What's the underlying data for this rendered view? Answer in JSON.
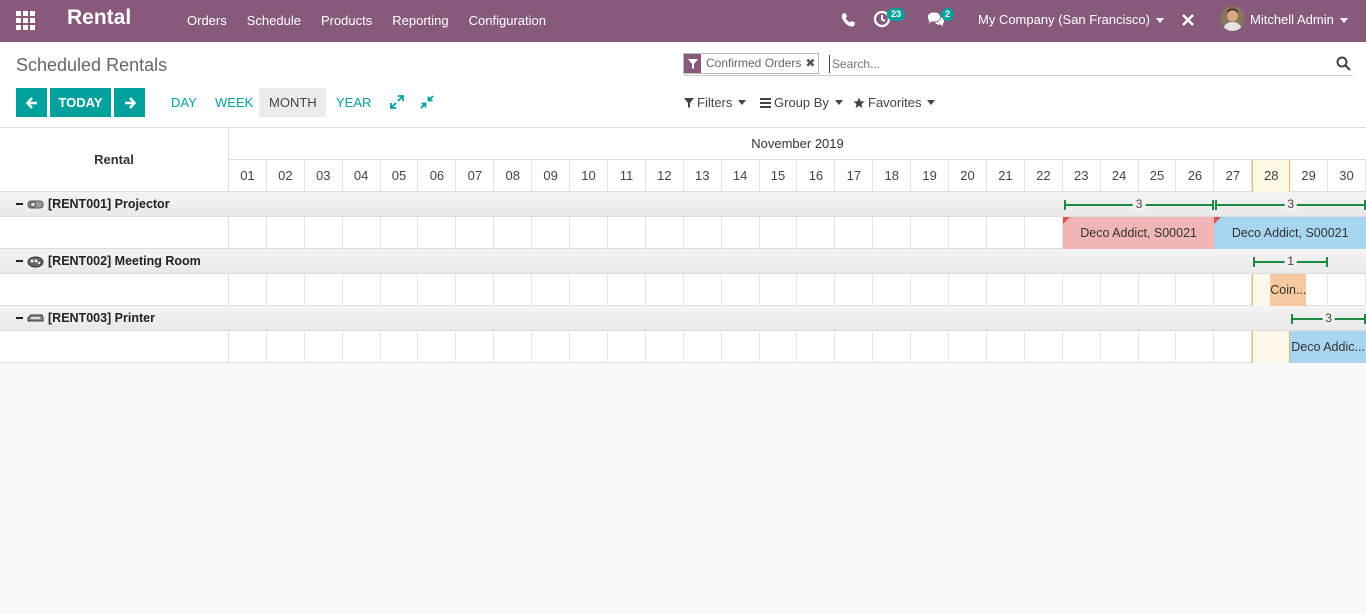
{
  "navbar": {
    "brand": "Rental",
    "menu": [
      "Orders",
      "Schedule",
      "Products",
      "Reporting",
      "Configuration"
    ],
    "activity_count": "23",
    "message_count": "2",
    "company": "My Company (San Francisco)",
    "user": "Mitchell Admin",
    "bg_color": "#875a7b"
  },
  "control": {
    "breadcrumb": "Scheduled Rentals",
    "today_label": "TODAY",
    "scales": [
      "DAY",
      "WEEK",
      "MONTH",
      "YEAR"
    ],
    "active_scale": "MONTH",
    "facet_label": "Confirmed Orders",
    "search_placeholder": "Search...",
    "filters_label": "Filters",
    "groupby_label": "Group By",
    "favorites_label": "Favorites",
    "accent_color": "#00a09d"
  },
  "gantt": {
    "row_header": "Rental",
    "month": "November 2019",
    "days": [
      "01",
      "02",
      "03",
      "04",
      "05",
      "06",
      "07",
      "08",
      "09",
      "10",
      "11",
      "12",
      "13",
      "14",
      "15",
      "16",
      "17",
      "18",
      "19",
      "20",
      "21",
      "22",
      "23",
      "24",
      "25",
      "26",
      "27",
      "28",
      "29",
      "30"
    ],
    "today": "28",
    "groups": [
      {
        "label": "[RENT001] Projector",
        "icon": "projector-icon",
        "brackets": [
          {
            "count": "3",
            "from": "23",
            "to": "26"
          },
          {
            "count": "3",
            "from": "27",
            "to": "30"
          }
        ],
        "pills": [
          {
            "text": "Deco Addict, S00021",
            "from": "23",
            "to": "26",
            "color": "#f2b5b5",
            "corner": true
          },
          {
            "text": "Deco Addict, S00021",
            "from": "27",
            "to": "30",
            "color": "#a8d5f0",
            "corner": true
          }
        ]
      },
      {
        "label": "[RENT002] Meeting Room",
        "icon": "meeting-room-icon",
        "brackets": [
          {
            "count": "1",
            "from": "28",
            "to": "29"
          }
        ],
        "pills": [
          {
            "text": "Coin...",
            "from": "28",
            "to": "28",
            "color": "#f7c9a0",
            "corner": false
          }
        ]
      },
      {
        "label": "[RENT003] Printer",
        "icon": "printer-icon",
        "brackets": [
          {
            "count": "3",
            "from": "29",
            "to": "30"
          }
        ],
        "pills": [
          {
            "text": "Deco Addic...",
            "from": "29",
            "to": "30",
            "color": "#a8d5f0",
            "corner": false
          }
        ]
      }
    ]
  }
}
